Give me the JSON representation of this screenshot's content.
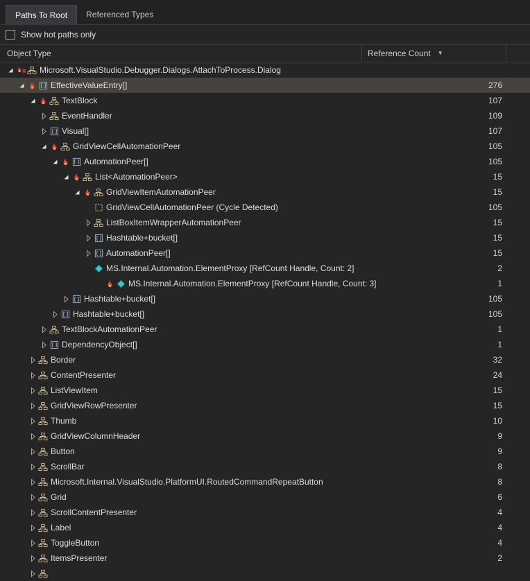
{
  "tabs": [
    {
      "label": "Paths To Root",
      "active": true
    },
    {
      "label": "Referenced Types",
      "active": false
    }
  ],
  "filter": {
    "label": "Show hot paths only",
    "checked": false
  },
  "columns": {
    "object_type": "Object Type",
    "reference_count": "Reference Count",
    "sort_icon": "▼",
    "sort_direction": "desc"
  },
  "colors": {
    "background": "#252526",
    "text": "#dcdcdc",
    "selected_row": "#45433b",
    "flame": "#dd5145",
    "flame_inner": "#f2a057",
    "class_icon": "#cdb981",
    "array_icon": "#9fb4c7",
    "proxy_icon": "#3ec6cf",
    "cycle_icon": "#d8d4a8",
    "expander_expanded": "#e2e2e2",
    "expander_collapsed": "#a0a0a0"
  },
  "tree": {
    "rows": [
      {
        "level": 0,
        "expander": "expanded",
        "icons": [
          "flame-equals",
          "class"
        ],
        "label": "Microsoft.VisualStudio.Debugger.Dialogs.AttachToProcess.Dialog",
        "count": "",
        "selected": false
      },
      {
        "level": 1,
        "expander": "expanded",
        "icons": [
          "flame",
          "array"
        ],
        "label": "EffectiveValueEntry[]",
        "count": "276",
        "selected": true
      },
      {
        "level": 2,
        "expander": "expanded",
        "icons": [
          "flame",
          "class"
        ],
        "label": "TextBlock",
        "count": "107",
        "selected": false
      },
      {
        "level": 3,
        "expander": "collapsed",
        "icons": [
          "class"
        ],
        "label": "EventHandler",
        "count": "109",
        "selected": false
      },
      {
        "level": 3,
        "expander": "collapsed",
        "icons": [
          "array"
        ],
        "label": "Visual[]",
        "count": "107",
        "selected": false
      },
      {
        "level": 3,
        "expander": "expanded",
        "icons": [
          "flame",
          "class"
        ],
        "label": "GridViewCellAutomationPeer",
        "count": "105",
        "selected": false
      },
      {
        "level": 4,
        "expander": "expanded",
        "icons": [
          "flame",
          "array"
        ],
        "label": "AutomationPeer[]",
        "count": "105",
        "selected": false
      },
      {
        "level": 5,
        "expander": "expanded",
        "icons": [
          "flame",
          "class"
        ],
        "label": "List<AutomationPeer>",
        "count": "15",
        "selected": false
      },
      {
        "level": 6,
        "expander": "expanded",
        "icons": [
          "flame",
          "class"
        ],
        "label": "GridViewItemAutomationPeer",
        "count": "15",
        "selected": false
      },
      {
        "level": 7,
        "expander": "none",
        "icons": [
          "cycle"
        ],
        "label": "GridViewCellAutomationPeer (Cycle Detected)",
        "count": "105",
        "selected": false
      },
      {
        "level": 7,
        "expander": "collapsed",
        "icons": [
          "class"
        ],
        "label": "ListBoxItemWrapperAutomationPeer",
        "count": "15",
        "selected": false
      },
      {
        "level": 7,
        "expander": "collapsed",
        "icons": [
          "array"
        ],
        "label": "Hashtable+bucket[]",
        "count": "15",
        "selected": false
      },
      {
        "level": 7,
        "expander": "collapsed",
        "icons": [
          "array"
        ],
        "label": "AutomationPeer[]",
        "count": "15",
        "selected": false
      },
      {
        "level": 7,
        "expander": "none",
        "icons": [
          "proxy"
        ],
        "label": "MS.Internal.Automation.ElementProxy [RefCount Handle, Count: 2]",
        "count": "2",
        "selected": false
      },
      {
        "level": 8,
        "expander": "none",
        "icons": [
          "flame",
          "proxy"
        ],
        "label": "MS.Internal.Automation.ElementProxy [RefCount Handle, Count: 3]",
        "count": "1",
        "selected": false
      },
      {
        "level": 5,
        "expander": "collapsed",
        "icons": [
          "array"
        ],
        "label": "Hashtable+bucket[]",
        "count": "105",
        "selected": false
      },
      {
        "level": 4,
        "expander": "collapsed",
        "icons": [
          "array"
        ],
        "label": "Hashtable+bucket[]",
        "count": "105",
        "selected": false
      },
      {
        "level": 3,
        "expander": "collapsed",
        "icons": [
          "class"
        ],
        "label": "TextBlockAutomationPeer",
        "count": "1",
        "selected": false
      },
      {
        "level": 3,
        "expander": "collapsed",
        "icons": [
          "array"
        ],
        "label": "DependencyObject[]",
        "count": "1",
        "selected": false
      },
      {
        "level": 2,
        "expander": "collapsed",
        "icons": [
          "class"
        ],
        "label": "Border",
        "count": "32",
        "selected": false
      },
      {
        "level": 2,
        "expander": "collapsed",
        "icons": [
          "class"
        ],
        "label": "ContentPresenter",
        "count": "24",
        "selected": false
      },
      {
        "level": 2,
        "expander": "collapsed",
        "icons": [
          "class"
        ],
        "label": "ListViewItem",
        "count": "15",
        "selected": false
      },
      {
        "level": 2,
        "expander": "collapsed",
        "icons": [
          "class"
        ],
        "label": "GridViewRowPresenter",
        "count": "15",
        "selected": false
      },
      {
        "level": 2,
        "expander": "collapsed",
        "icons": [
          "class"
        ],
        "label": "Thumb",
        "count": "10",
        "selected": false
      },
      {
        "level": 2,
        "expander": "collapsed",
        "icons": [
          "class"
        ],
        "label": "GridViewColumnHeader",
        "count": "9",
        "selected": false
      },
      {
        "level": 2,
        "expander": "collapsed",
        "icons": [
          "class"
        ],
        "label": "Button",
        "count": "9",
        "selected": false
      },
      {
        "level": 2,
        "expander": "collapsed",
        "icons": [
          "class"
        ],
        "label": "ScrollBar",
        "count": "8",
        "selected": false
      },
      {
        "level": 2,
        "expander": "collapsed",
        "icons": [
          "class"
        ],
        "label": "Microsoft.Internal.VisualStudio.PlatformUI.RoutedCommandRepeatButton",
        "count": "8",
        "selected": false
      },
      {
        "level": 2,
        "expander": "collapsed",
        "icons": [
          "class"
        ],
        "label": "Grid",
        "count": "6",
        "selected": false
      },
      {
        "level": 2,
        "expander": "collapsed",
        "icons": [
          "class"
        ],
        "label": "ScrollContentPresenter",
        "count": "4",
        "selected": false
      },
      {
        "level": 2,
        "expander": "collapsed",
        "icons": [
          "class"
        ],
        "label": "Label",
        "count": "4",
        "selected": false
      },
      {
        "level": 2,
        "expander": "collapsed",
        "icons": [
          "class"
        ],
        "label": "ToggleButton",
        "count": "4",
        "selected": false
      },
      {
        "level": 2,
        "expander": "collapsed",
        "icons": [
          "class"
        ],
        "label": "ItemsPresenter",
        "count": "2",
        "selected": false
      },
      {
        "level": 2,
        "expander": "collapsed",
        "icons": [
          "class"
        ],
        "label": "",
        "count": "",
        "selected": false
      }
    ]
  }
}
